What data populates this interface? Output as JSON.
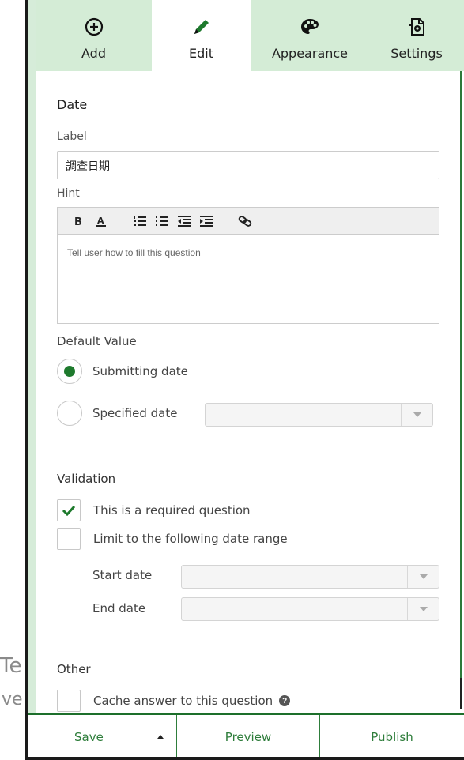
{
  "background": {
    "peek_text_1": "Te",
    "peek_text_2": "ve"
  },
  "tabs": [
    {
      "label": "Add",
      "icon": "plus-circle-icon"
    },
    {
      "label": "Edit",
      "icon": "pencil-icon"
    },
    {
      "label": "Appearance",
      "icon": "palette-icon"
    },
    {
      "label": "Settings",
      "icon": "settings-doc-icon"
    }
  ],
  "active_tab": "Edit",
  "question": {
    "type_title": "Date",
    "label_caption": "Label",
    "label_value": "調查日期",
    "hint_caption": "Hint",
    "hint_placeholder": "Tell user how to fill this question",
    "default_value_caption": "Default Value",
    "option_submitting": "Submitting date",
    "option_specified": "Specified date",
    "selected_default": "Submitting date"
  },
  "validation": {
    "title": "Validation",
    "required_label": "This is a required question",
    "required_checked": true,
    "range_label": "Limit to the following date range",
    "range_checked": false,
    "start_label": "Start date",
    "end_label": "End date"
  },
  "other": {
    "title": "Other",
    "cache_label": "Cache answer to this question",
    "cache_checked": false
  },
  "footer": {
    "save": "Save",
    "preview": "Preview",
    "publish": "Publish"
  },
  "colors": {
    "accent_green": "#1e7a2d",
    "tab_bg": "#d4ecd6"
  }
}
